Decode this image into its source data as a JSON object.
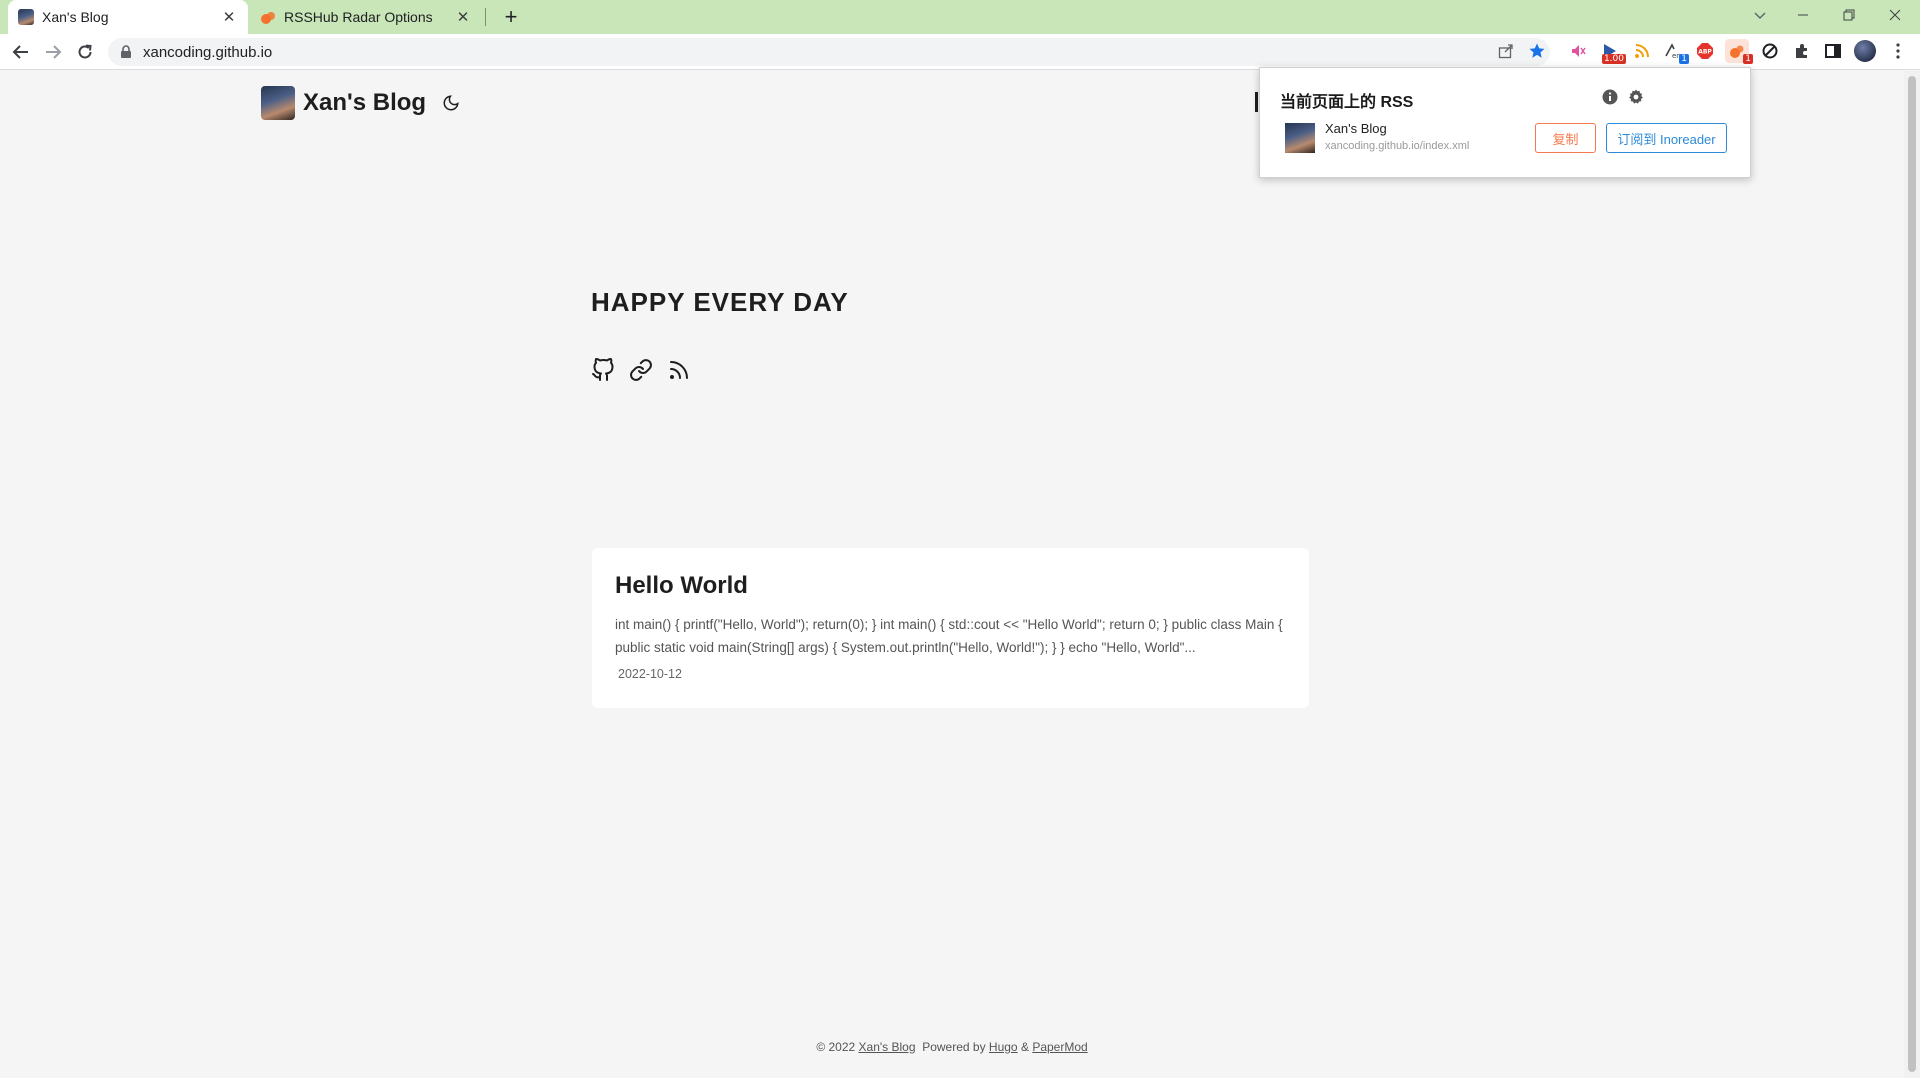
{
  "browser": {
    "tabs": [
      {
        "title": "Xan's Blog",
        "close": "✕"
      },
      {
        "title": "RSSHub Radar Options",
        "close": "✕"
      }
    ],
    "new_tab": "+",
    "address": "xancoding.github.io",
    "extension_badges": {
      "speed": "1.00",
      "translate": "1",
      "rsshub": "1",
      "abp": "ABP"
    }
  },
  "site": {
    "title": "Xan's Blog"
  },
  "hero": {
    "title": "HAPPY EVERY DAY"
  },
  "posts": [
    {
      "title": "Hello World",
      "summary": "int main() { printf(\"Hello, World\"); return(0); } int main() { std::cout << \"Hello World\"; return 0; } public class Main { public static void main(String[] args) { System.out.println(\"Hello, World!\"); } } echo \"Hello, World\"...",
      "date": "2022-10-12"
    }
  ],
  "footer": {
    "copyright": "© 2022",
    "site_link": "Xan's Blog",
    "powered_by": "Powered by",
    "hugo": "Hugo",
    "amp": "&",
    "theme": "PaperMod"
  },
  "rss_popup": {
    "title": "当前页面上的 RSS",
    "feed_name": "Xan's Blog",
    "feed_url": "xancoding.github.io/index.xml",
    "copy_label": "复制",
    "subscribe_label": "订阅到 Inoreader",
    "colors": {
      "copy": "#f5794e",
      "subscribe": "#2d8ad8"
    }
  },
  "colors": {
    "tabbar": "#c9e6b8",
    "page_bg": "#f5f5f5"
  }
}
